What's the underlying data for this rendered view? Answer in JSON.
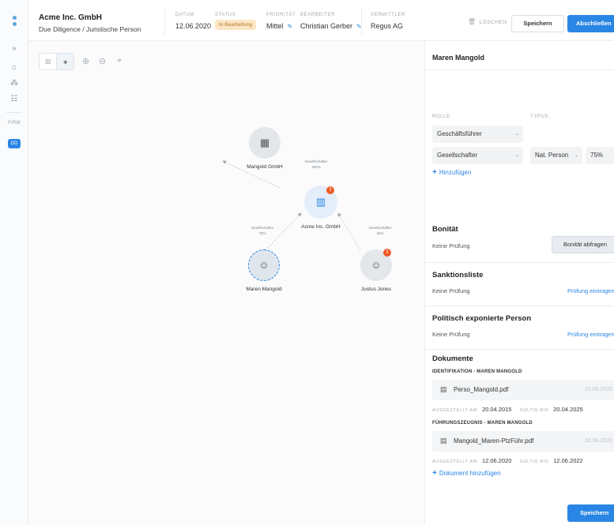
{
  "header": {
    "company_name": "Acme Inc. GmbH",
    "company_sub": "Due Diligence / Juristische Person",
    "date_label": "DATUM",
    "date_value": "12.06.2020",
    "status_label": "STATUS",
    "status_value": "In Bearbeitung",
    "priority_label": "PRIORITÄT",
    "priority_value": "Mittel",
    "editor_label": "BEARBEITER",
    "editor_value": "Christian Gerber",
    "broker_label": "VERMITTLER",
    "broker_value": "Regus AG",
    "delete_label": "LÖSCHEN",
    "save_label": "Speichern",
    "finish_label": "Abschließen"
  },
  "sidebar": {
    "firm_label": "FIRM",
    "badge": "DD"
  },
  "graph": {
    "nodes": {
      "mangold_gmbh": "Mangold GmbH",
      "acme": "Acme Inc. GmbH",
      "maren": "Maren Mangold",
      "justus": "Justus Jones"
    },
    "edges": {
      "mangold_to_acme": "Gesellschafter\n100%",
      "maren_to_acme": "Gesellschafter\n75%",
      "justus_to_acme": "Gesellschafter\n25%"
    }
  },
  "panel": {
    "title": "Maren Mangold",
    "rolle_label": "ROLLE:",
    "typus_label": "TYPUS:",
    "role1": "Geschäftsführer",
    "role2": "Gesellschafter",
    "typus_value": "Nat. Person",
    "percent_value": "75%",
    "add_label": "Hinzufügen",
    "bonitaet_title": "Bonität",
    "bonitaet_sub": "Keine Prüfung",
    "bonitaet_button": "Bonität abfragen",
    "sanktion_title": "Sanktionsliste",
    "sanktion_sub": "Keine Prüfung",
    "sanktion_link": "Prüfung eintragen",
    "pep_title": "Politisch exponierte Person",
    "pep_sub": "Keine Prüfung",
    "pep_link": "Prüfung eintragen",
    "docs_title": "Dokumente",
    "doc1_category": "IDENTIFIKATION - MAREN MANGOLD",
    "doc1_name": "Perso_Mangold.pdf",
    "doc1_date": "15.06.2020",
    "doc1_issued_label": "AUSGESTELLT AM:",
    "doc1_issued": "20.04.2015",
    "doc1_valid_label": "GÜLTIG BIS:",
    "doc1_valid": "20.04.2025",
    "doc2_category": "FÜHRUNGSZEUGNIS - MAREN MANGOLD",
    "doc2_name": "Mangold_Maren-PtzFühr.pdf",
    "doc2_date": "16.06.2020",
    "doc2_issued_label": "AUSGESTELLT AM:",
    "doc2_issued": "12.06.2020",
    "doc2_valid_label": "GÜLTIG BIS:",
    "doc2_valid": "12.06.2022",
    "add_doc_label": "Dokument hinzufügen",
    "save_label": "Speichern"
  }
}
